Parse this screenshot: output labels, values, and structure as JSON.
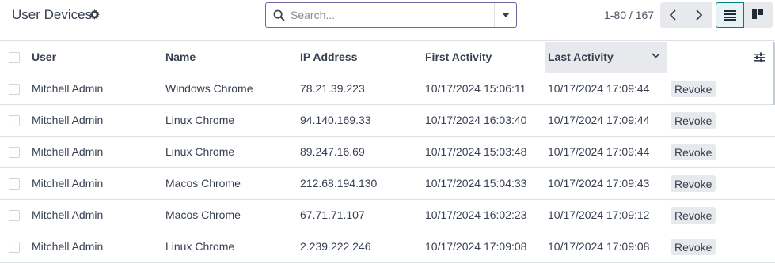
{
  "header": {
    "title": "User Devices",
    "title_icon": "gear-icon"
  },
  "search": {
    "placeholder": "Search...",
    "value": "",
    "icon": "search-icon",
    "toggle_icon": "caret-down-icon"
  },
  "pager": {
    "value": "1-80 / 167",
    "prev_icon": "chevron-left-icon",
    "next_icon": "chevron-right-icon"
  },
  "views": {
    "list_icon": "list-view-icon",
    "kanban_icon": "kanban-view-icon",
    "active": "list"
  },
  "table": {
    "columns": [
      "User",
      "Name",
      "IP Address",
      "First Activity",
      "Last Activity"
    ],
    "sorted_column": "Last Activity",
    "sort_direction": "descending",
    "action_label": "Revoke",
    "rows": [
      {
        "user": "Mitchell Admin",
        "name": "Windows Chrome",
        "ip": "78.21.39.223",
        "first": "10/17/2024 15:06:11",
        "last": "10/17/2024 17:09:44"
      },
      {
        "user": "Mitchell Admin",
        "name": "Linux Chrome",
        "ip": "94.140.169.33",
        "first": "10/17/2024 16:03:40",
        "last": "10/17/2024 17:09:44"
      },
      {
        "user": "Mitchell Admin",
        "name": "Linux Chrome",
        "ip": "89.247.16.69",
        "first": "10/17/2024 15:03:48",
        "last": "10/17/2024 17:09:44"
      },
      {
        "user": "Mitchell Admin",
        "name": "Macos Chrome",
        "ip": "212.68.194.130",
        "first": "10/17/2024 15:04:33",
        "last": "10/17/2024 17:09:43"
      },
      {
        "user": "Mitchell Admin",
        "name": "Macos Chrome",
        "ip": "67.71.71.107",
        "first": "10/17/2024 16:02:23",
        "last": "10/17/2024 17:09:12"
      },
      {
        "user": "Mitchell Admin",
        "name": "Linux Chrome",
        "ip": "2.239.222.246",
        "first": "10/17/2024 17:09:08",
        "last": "10/17/2024 17:09:08"
      }
    ]
  },
  "colors": {
    "accent": "#017e84",
    "search_border": "#71639e",
    "button_bg": "#e7e9ed"
  }
}
